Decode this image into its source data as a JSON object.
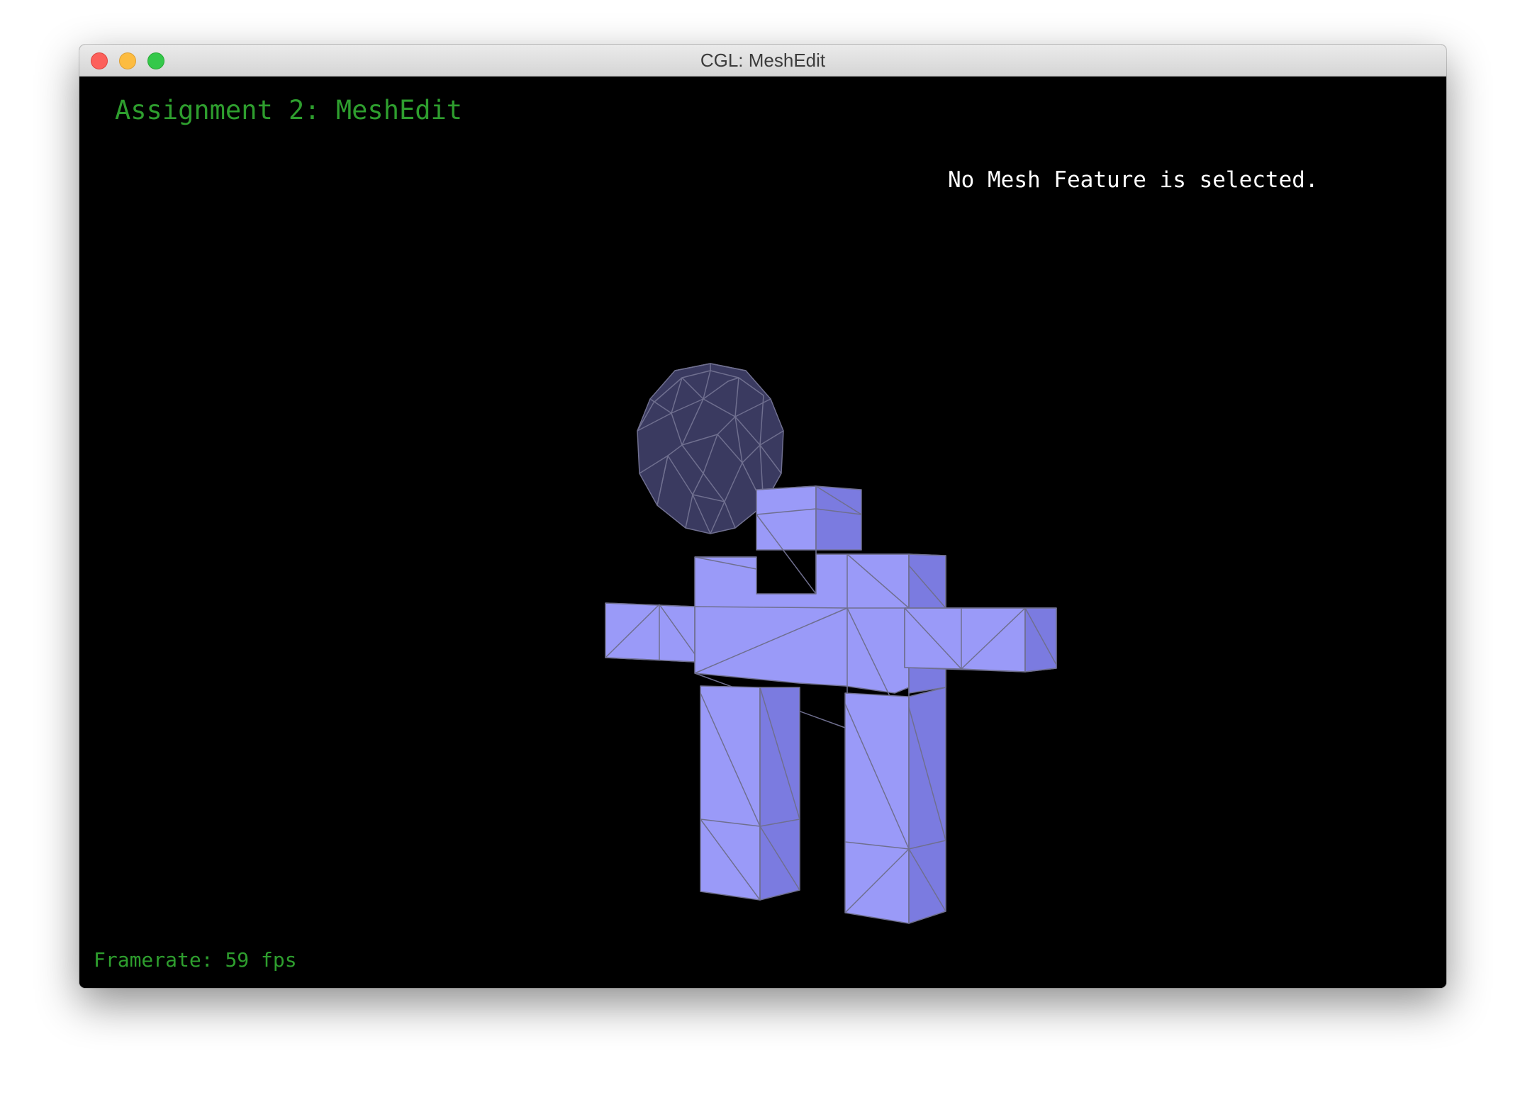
{
  "window": {
    "title": "CGL: MeshEdit"
  },
  "viewport": {
    "assignment_title": "Assignment 2: MeshEdit",
    "selection_status": "No Mesh Feature is selected.",
    "framerate_label": "Framerate:",
    "framerate_value": "59 fps"
  },
  "colors": {
    "background": "#000000",
    "hud_green": "#2e9e2e",
    "mesh_front": "#9a9af8",
    "mesh_side": "#7b7be0",
    "sphere_fill": "#3a3a60",
    "wire": "#6f6f8f"
  },
  "scene": {
    "objects": [
      "icosphere-head",
      "box-humanoid-body"
    ]
  }
}
